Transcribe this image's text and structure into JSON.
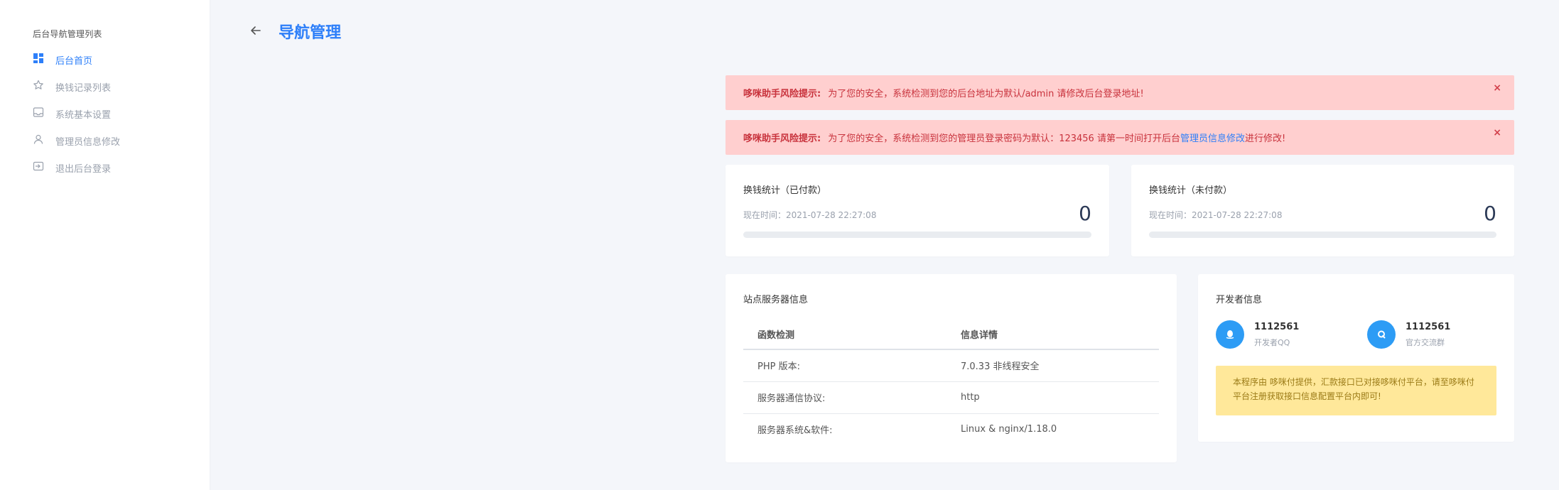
{
  "sidebar": {
    "heading": "后台导航管理列表",
    "items": [
      {
        "label": "后台首页",
        "icon": "dashboard-icon",
        "active": true
      },
      {
        "label": "换钱记录列表",
        "icon": "star-icon",
        "active": false
      },
      {
        "label": "系统基本设置",
        "icon": "inbox-icon",
        "active": false
      },
      {
        "label": "管理员信息修改",
        "icon": "user-icon",
        "active": false
      },
      {
        "label": "退出后台登录",
        "icon": "logout-icon",
        "active": false
      }
    ]
  },
  "header": {
    "title": "导航管理",
    "back_icon": "arrow-left-icon"
  },
  "alerts": [
    {
      "title": "哆咪助手风险提示:",
      "text": "为了您的安全，系统检测到您的后台地址为默认/admin 请修改后台登录地址!",
      "close": "×"
    },
    {
      "title": "哆咪助手风险提示:",
      "text_before": "为了您的安全，系统检测到您的管理员登录密码为默认：123456 请第一时间打开后台",
      "link": "管理员信息修改",
      "text_after": "进行修改!",
      "close": "×"
    }
  ],
  "stats": [
    {
      "title": "换钱统计（已付款）",
      "time": "现在时间：2021-07-28 22:27:08",
      "value": "0",
      "progress": 0
    },
    {
      "title": "换钱统计（未付款）",
      "time": "现在时间：2021-07-28 22:27:08",
      "value": "0",
      "progress": 0
    }
  ],
  "server": {
    "title": "站点服务器信息",
    "columns": [
      "函数检测",
      "信息详情"
    ],
    "rows": [
      [
        "PHP 版本:",
        "7.0.33 非线程安全"
      ],
      [
        "服务器通信协议:",
        "http"
      ],
      [
        "服务器系统&软件:",
        "Linux & nginx/1.18.0"
      ]
    ]
  },
  "developer": {
    "title": "开发者信息",
    "contacts": [
      {
        "number": "1112561",
        "label": "开发者QQ",
        "icon": "qq-penguin-icon"
      },
      {
        "number": "1112561",
        "label": "官方交流群",
        "icon": "qq-group-icon"
      }
    ],
    "notice": "本程序由 哆咪付提供，汇款接口已对接哆咪付平台，请至哆咪付平台注册获取接口信息配置平台内即可!"
  },
  "colors": {
    "accent": "#2d7ff9",
    "alert_bg": "#ffcfcf",
    "alert_text": "#c8323c",
    "notice_bg": "#ffe89a",
    "avatar_bg": "#2d9cf5",
    "page_bg": "#f4f6fa"
  }
}
